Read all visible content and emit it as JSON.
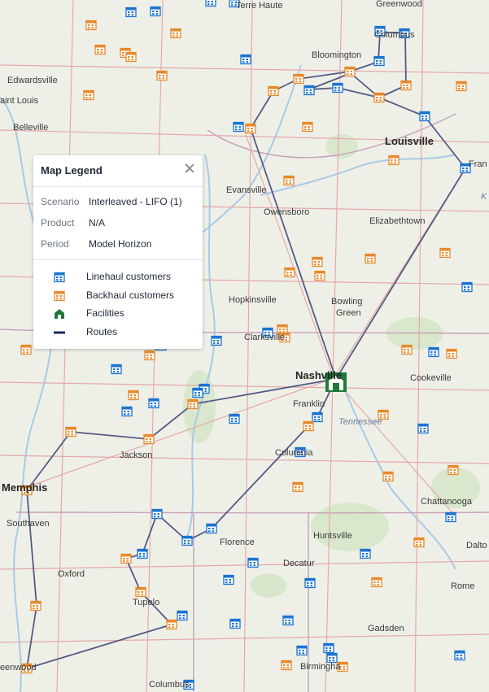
{
  "legend": {
    "title": "Map Legend",
    "meta": [
      {
        "key": "Scenario",
        "value": "Interleaved - LIFO (1)"
      },
      {
        "key": "Product",
        "value": "N/A"
      },
      {
        "key": "Period",
        "value": "Model Horizon"
      }
    ],
    "items": [
      {
        "label": "Linehaul customers",
        "icon": "linehaul-customer-icon",
        "color": "#1a73d1"
      },
      {
        "label": "Backhaul customers",
        "icon": "backhaul-customer-icon",
        "color": "#e8892a"
      },
      {
        "label": "Facilities",
        "icon": "facility-icon",
        "color": "#1f7a3a"
      },
      {
        "label": "Routes",
        "icon": "route-line-icon",
        "color": "#1b2a5c"
      }
    ]
  },
  "colors": {
    "linehaul": "#1a73d1",
    "backhaul": "#e8892a",
    "facility": "#1f7a3a",
    "route": "#545a85",
    "map_background": "#eef0e8"
  },
  "map_labels": {
    "greenwood_n": "Greenwood",
    "terre_haute": "Terre Haute",
    "columbus_in": "Columbus",
    "bloomington": "Bloomington",
    "edwardsville": "Edwardsville",
    "saint_louis": "aint Louis",
    "belleville": "Belleville",
    "louisville": "Louisville",
    "frankfort": "Fran",
    "evansville": "Evansville",
    "owensboro": "Owensboro",
    "elizabethtown": "Elizabethtown",
    "hopkinsville": "Hopkinsville",
    "bowling_green_1": "Bowling",
    "bowling_green_2": "Green",
    "clarksville": "Clarksville",
    "nashville": "Nashville",
    "cookeville": "Cookeville",
    "franklin": "Franklin",
    "tennessee": "Tennessee",
    "jackson": "Jackson",
    "columbia": "Columbia",
    "memphis": "Memphis",
    "southaven": "Southaven",
    "chattanooga": "Chattanooga",
    "huntsville": "Huntsville",
    "florence": "Florence",
    "dalton": "Dalto",
    "oxford": "Oxford",
    "decatur": "Decatur",
    "tupelo": "Tupelo",
    "rome": "Rome",
    "gadsden": "Gadsden",
    "greenwood_s": "eenwood",
    "birmingham": "Birmingha",
    "columbus_ms": "Columbus",
    "ky": "K"
  }
}
